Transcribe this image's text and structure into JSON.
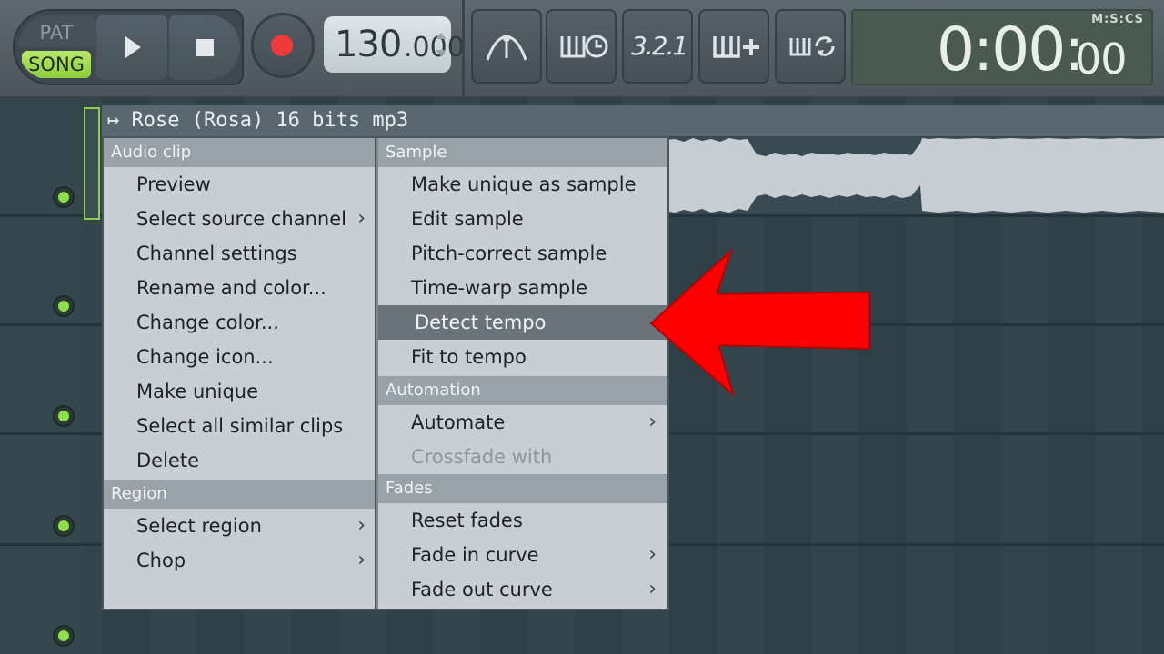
{
  "transport": {
    "pat_label": "PAT",
    "song_label": "SONG",
    "tempo_integer": "130",
    "tempo_decimal": ".000"
  },
  "tools": {
    "metronome": "metronome-icon",
    "wait_record": "wait-record-icon",
    "countdown": "countdown-icon",
    "step_edit": "step-edit-icon",
    "loop_record": "loop-record-icon",
    "countdown_text": "3.2.1"
  },
  "time_display": {
    "format": "M:S:CS",
    "main": "0:00:",
    "cs": "00"
  },
  "clip": {
    "title": "Rose (Rosa) 16 bits mp3",
    "header_icon": "clip-arrow-icon"
  },
  "menu_left": {
    "section_audio_clip": "Audio clip",
    "preview": "Preview",
    "select_source_channel": "Select source channel",
    "channel_settings": "Channel settings",
    "rename_and_color": "Rename and color...",
    "change_color": "Change color...",
    "change_icon": "Change icon...",
    "make_unique": "Make unique",
    "select_all_similar_clips": "Select all similar clips",
    "delete": "Delete",
    "section_region": "Region",
    "select_region": "Select region",
    "chop": "Chop"
  },
  "menu_right": {
    "section_sample": "Sample",
    "make_unique_as_sample": "Make unique as sample",
    "edit_sample": "Edit sample",
    "pitch_correct_sample": "Pitch-correct sample",
    "time_warp_sample": "Time-warp sample",
    "detect_tempo": "Detect tempo",
    "fit_to_tempo": "Fit to tempo",
    "section_automation": "Automation",
    "automate": "Automate",
    "crossfade_with": "Crossfade with",
    "section_fades": "Fades",
    "reset_fades": "Reset fades",
    "fade_in_curve": "Fade in curve",
    "fade_out_curve": "Fade out curve"
  },
  "submenu_chevron": "›",
  "colors": {
    "accent_green": "#8fcc3e",
    "record_red": "#f03a3a",
    "highlight": "#6a737a",
    "annotation_arrow": "#ff0000"
  }
}
